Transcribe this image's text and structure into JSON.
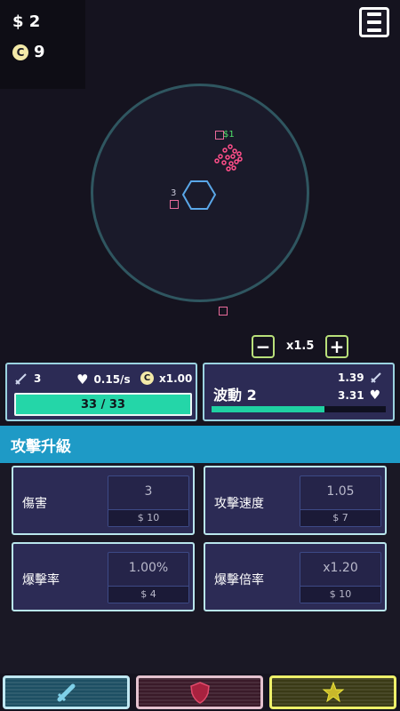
{
  "currency": {
    "cash": "$ 2",
    "coin_symbol": "C",
    "coins": "9"
  },
  "arena": {
    "cash_drop": "$1",
    "enemy_label": "3"
  },
  "zoom": {
    "minus": "−",
    "level": "x1.5",
    "plus": "+"
  },
  "player": {
    "attack": "3",
    "regen": "0.15/s",
    "coin_symbol": "C",
    "coin_multiplier": "x1.00",
    "hp": "33 / 33",
    "hp_fraction": 1.0
  },
  "wave": {
    "label": "波動 2",
    "enemy_attack": "1.39",
    "enemy_hp": "3.31",
    "progress_fraction": 0.65
  },
  "upgrades": {
    "title": "攻擊升級",
    "items": [
      {
        "name": "傷害",
        "value": "3",
        "price": "$ 10"
      },
      {
        "name": "攻擊速度",
        "value": "1.05",
        "price": "$ 7"
      },
      {
        "name": "爆擊率",
        "value": "1.00%",
        "price": "$ 4"
      },
      {
        "name": "爆擊倍率",
        "value": "x1.20",
        "price": "$ 10"
      }
    ]
  },
  "nav": {
    "tabs": [
      {
        "icon": "sword-icon",
        "color": "#7fd0e8"
      },
      {
        "icon": "shield-icon",
        "color": "#e04a6b"
      },
      {
        "icon": "star-icon",
        "color": "#e8e23a"
      }
    ]
  },
  "colors": {
    "accent": "#1e9ac6",
    "hp_bar": "#24d6a8",
    "panel": "#2c2b55"
  }
}
